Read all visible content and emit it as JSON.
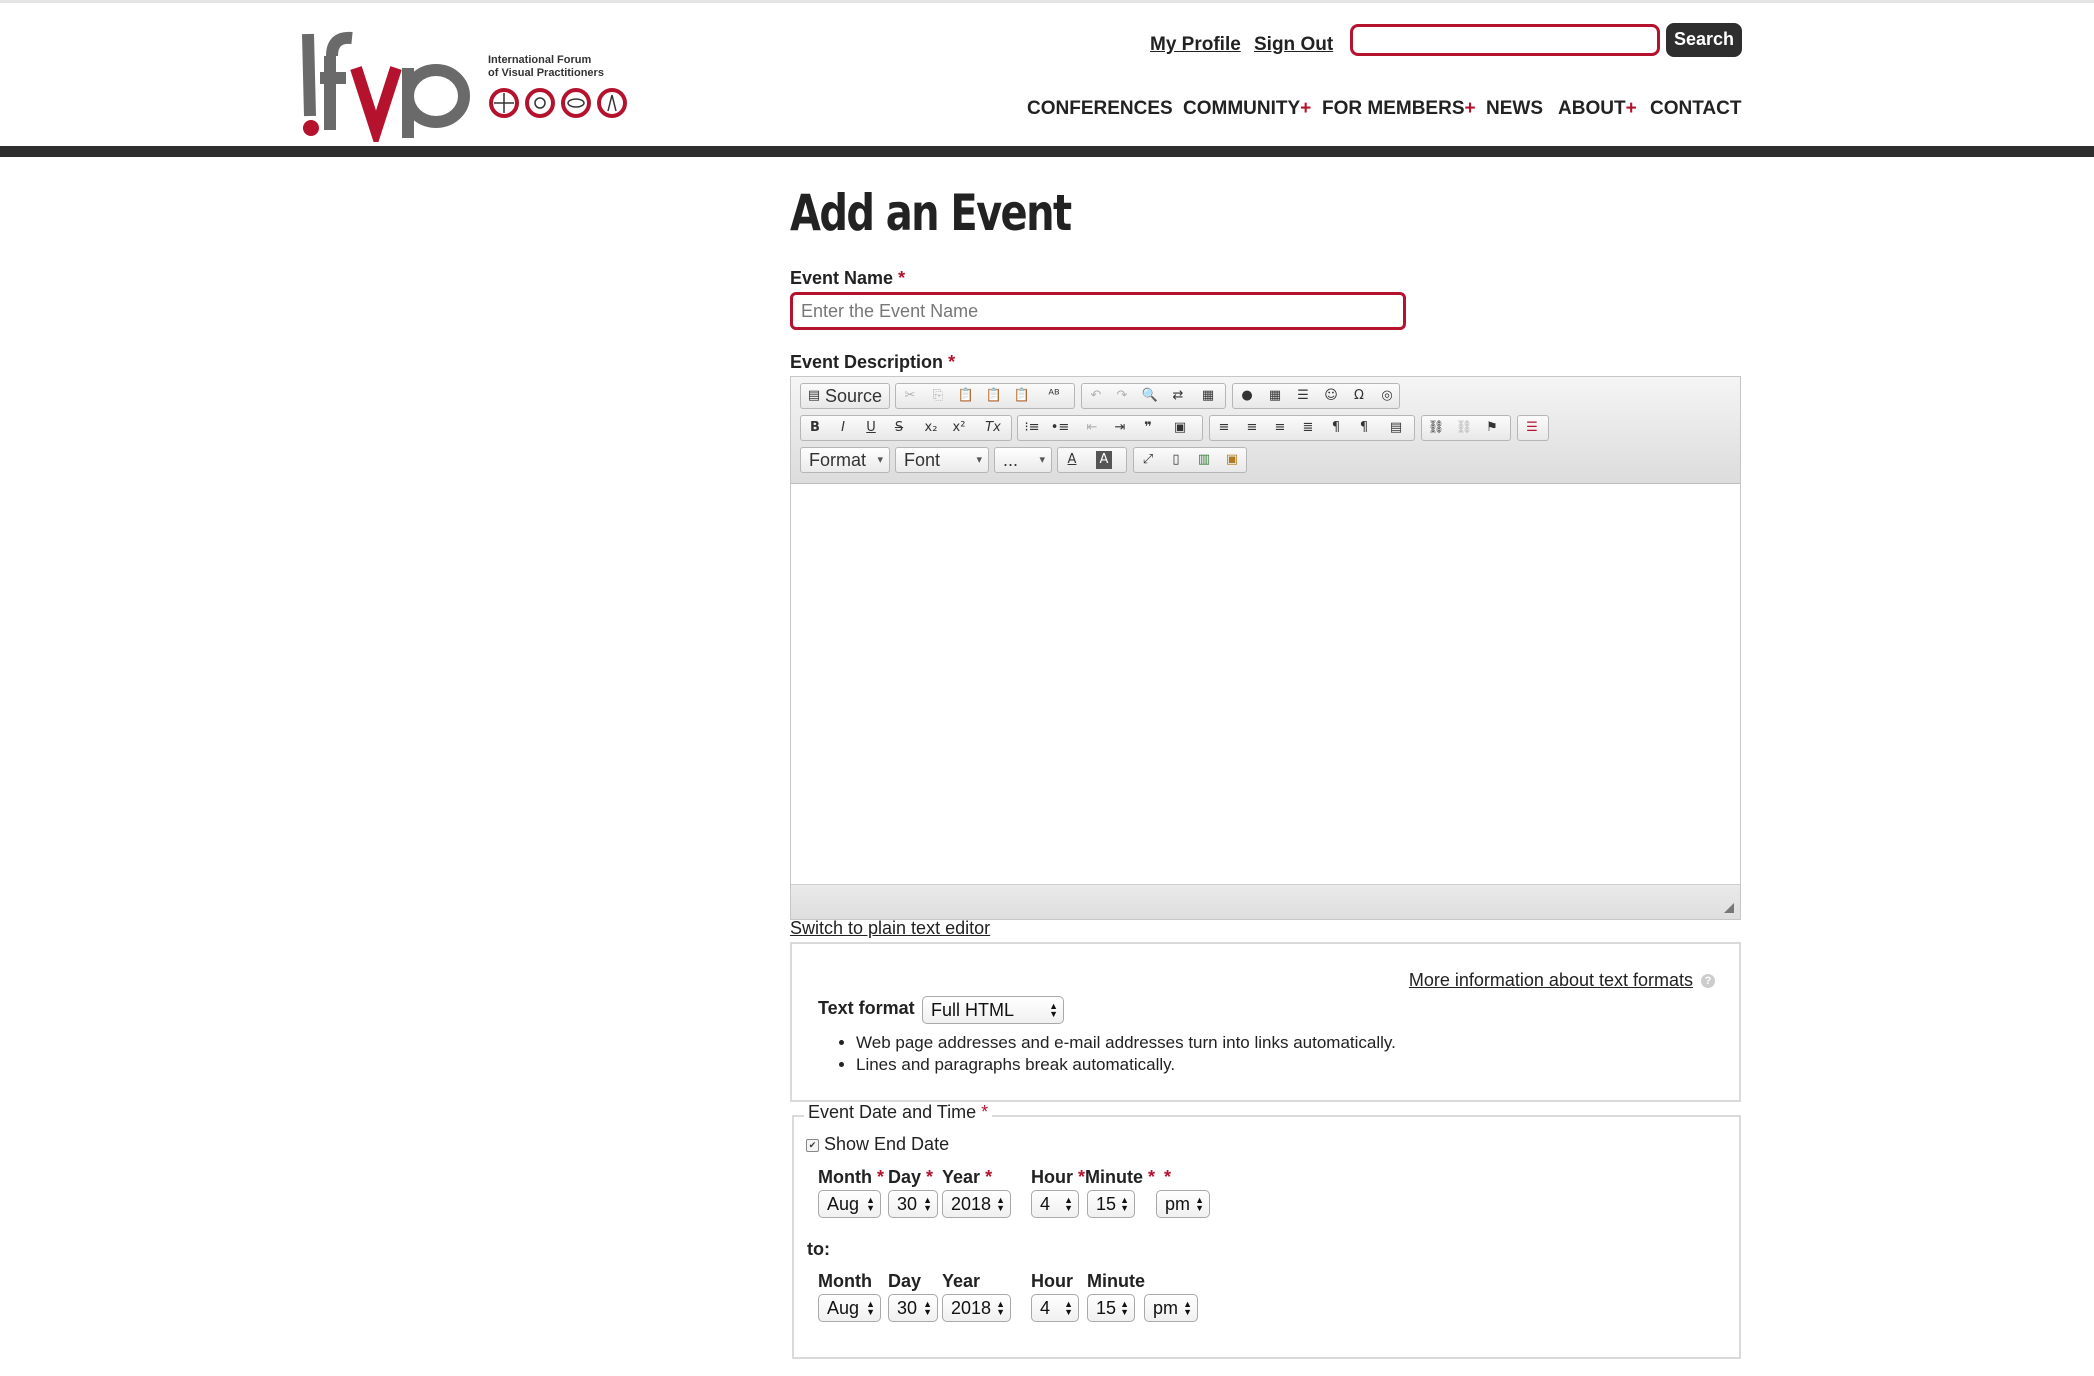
{
  "header": {
    "logo_main": "!fvp",
    "logo_line1": "International Forum",
    "logo_line2": "of Visual Practitioners",
    "my_profile": "My Profile",
    "sign_out": "Sign Out",
    "search_value": "",
    "search_button": "Search",
    "nav": [
      {
        "label": "CONFERENCES",
        "plus": ""
      },
      {
        "label": "COMMUNITY",
        "plus": "+"
      },
      {
        "label": "FOR MEMBERS",
        "plus": "+"
      },
      {
        "label": "NEWS",
        "plus": ""
      },
      {
        "label": "ABOUT",
        "plus": "+"
      },
      {
        "label": "CONTACT",
        "plus": ""
      }
    ]
  },
  "form": {
    "title": "Add an Event",
    "event_name_label": "Event Name",
    "required_mark": "*",
    "event_name_placeholder": "Enter the Event Name",
    "event_description_label": "Event Description",
    "editor": {
      "source_label": "Source",
      "format_combo": "Format",
      "font_combo": "Font",
      "size_combo": "...",
      "content": ""
    },
    "switch_plain_text": "Switch to plain text editor",
    "more_info_link": "More information about text formats",
    "help_glyph": "?",
    "text_format_label": "Text format",
    "text_format_value": "Full HTML",
    "format_tips": [
      "Web page addresses and e-mail addresses turn into links automatically.",
      "Lines and paragraphs break automatically."
    ],
    "date_legend": "Event Date and Time",
    "show_end_date_label": "Show End Date",
    "show_end_date_checked": true,
    "start": {
      "labels": {
        "month": "Month",
        "day": "Day",
        "year": "Year",
        "hour": "Hour",
        "minute": "Minute"
      },
      "month": "Aug",
      "day": "30",
      "year": "2018",
      "hour": "4",
      "minute": "15",
      "ampm": "pm"
    },
    "to_label": "to:",
    "end": {
      "labels": {
        "month": "Month",
        "day": "Day",
        "year": "Year",
        "hour": "Hour",
        "minute": "Minute"
      },
      "month": "Aug",
      "day": "30",
      "year": "2018",
      "hour": "4",
      "minute": "15",
      "ampm": "pm"
    }
  },
  "colors": {
    "brand_red": "#b5122e",
    "dark_bar": "#2e2e2e"
  }
}
